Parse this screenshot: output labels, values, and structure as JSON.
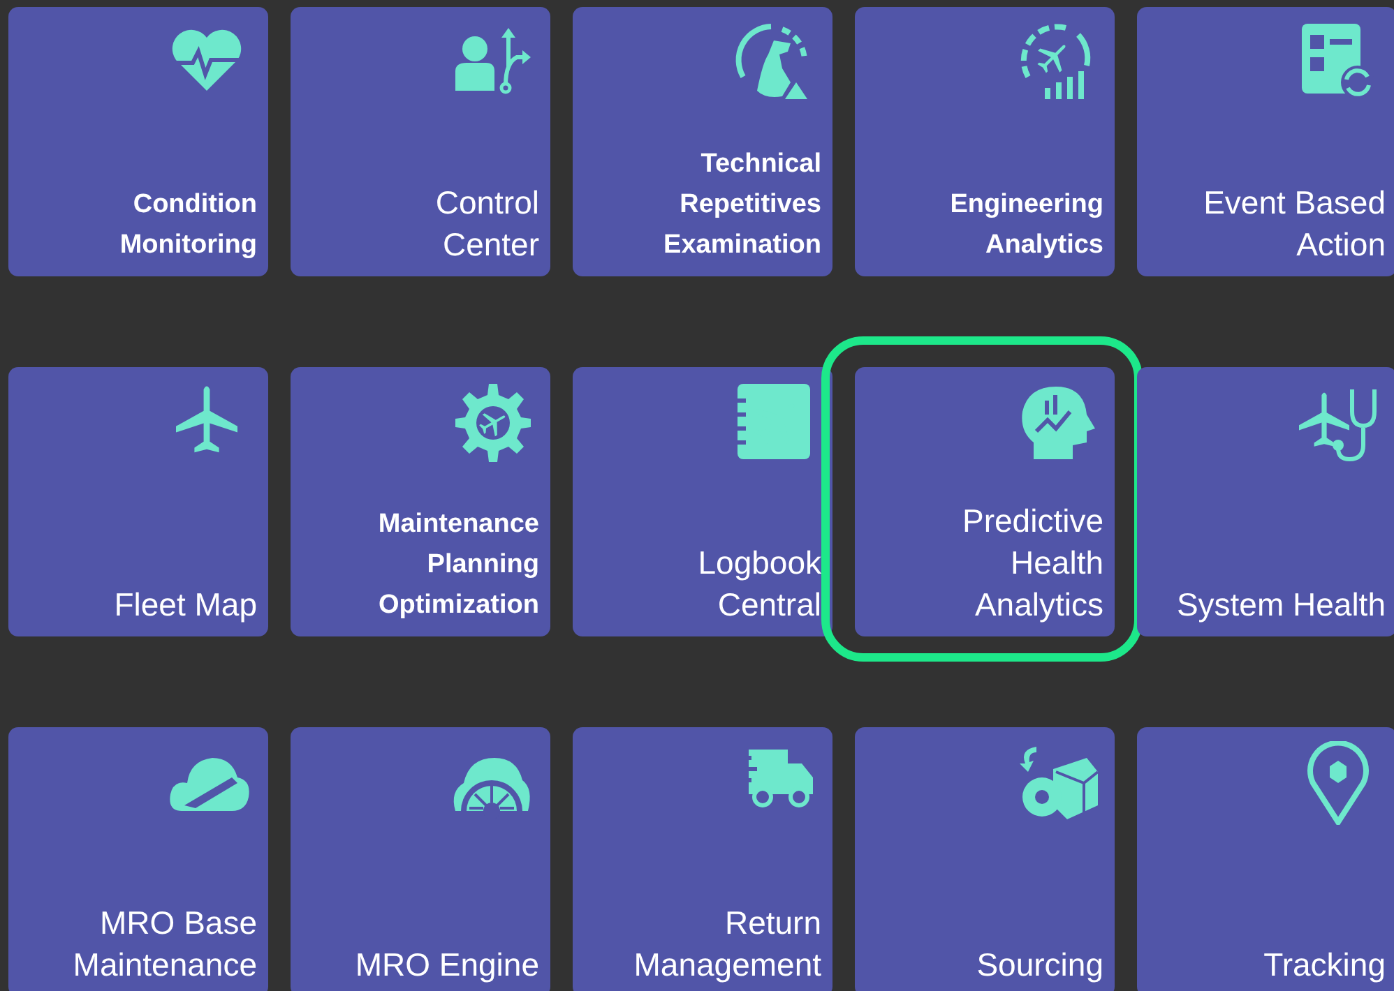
{
  "tiles": [
    {
      "lines": [
        "Condition",
        "Monitoring"
      ],
      "bold": true,
      "selected": false
    },
    {
      "lines": [
        "Control",
        "Center"
      ],
      "bold": false,
      "selected": false
    },
    {
      "lines": [
        "Technical",
        "Repetitives",
        "Examination"
      ],
      "bold": true,
      "selected": false
    },
    {
      "lines": [
        "Engineering",
        "Analytics"
      ],
      "bold": true,
      "selected": false
    },
    {
      "lines": [
        "Event Based",
        "Action"
      ],
      "bold": false,
      "selected": false
    },
    {
      "lines": [
        "Fleet Map"
      ],
      "bold": false,
      "selected": false
    },
    {
      "lines": [
        "Maintenance",
        "Planning",
        "Optimization"
      ],
      "bold": true,
      "selected": false
    },
    {
      "lines": [
        "Logbook",
        "Central"
      ],
      "bold": false,
      "selected": false
    },
    {
      "lines": [
        "Predictive",
        "Health",
        "Analytics"
      ],
      "bold": false,
      "selected": true
    },
    {
      "lines": [
        "System Health"
      ],
      "bold": false,
      "selected": false
    },
    {
      "lines": [
        "MRO Base",
        "Maintenance"
      ],
      "bold": false,
      "selected": false
    },
    {
      "lines": [
        "MRO Engine"
      ],
      "bold": false,
      "selected": false
    },
    {
      "lines": [
        "Return",
        "Management"
      ],
      "bold": false,
      "selected": false
    },
    {
      "lines": [
        "Sourcing"
      ],
      "bold": false,
      "selected": false
    },
    {
      "lines": [
        "Tracking"
      ],
      "bold": false,
      "selected": false
    }
  ]
}
